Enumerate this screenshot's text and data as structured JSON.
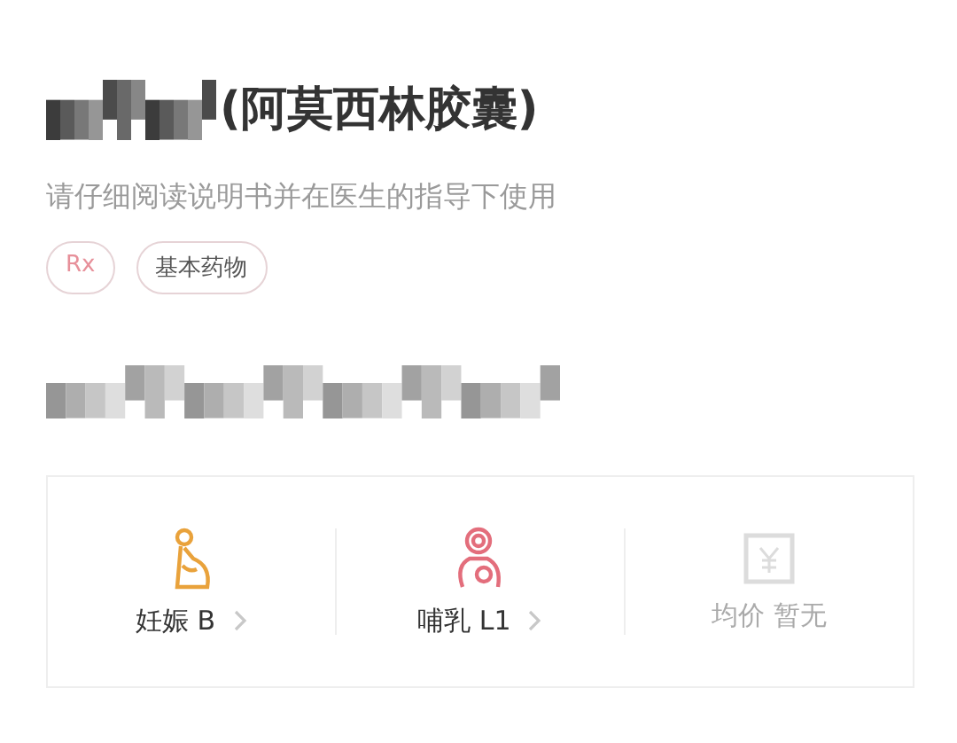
{
  "title": "(阿莫西林胶囊)",
  "notice": "请仔细阅读说明书并在医生的指导下使用",
  "tags": [
    {
      "label": "Rx",
      "color": "#e7909a"
    },
    {
      "label": "基本药物",
      "color": "#555555"
    }
  ],
  "stats": [
    {
      "kind": "pregnancy",
      "label": "妊娠 B",
      "disabled": false
    },
    {
      "kind": "lactation",
      "label": "哺乳 L1",
      "disabled": false
    },
    {
      "kind": "price",
      "label": "均价 暂无",
      "disabled": true
    }
  ]
}
